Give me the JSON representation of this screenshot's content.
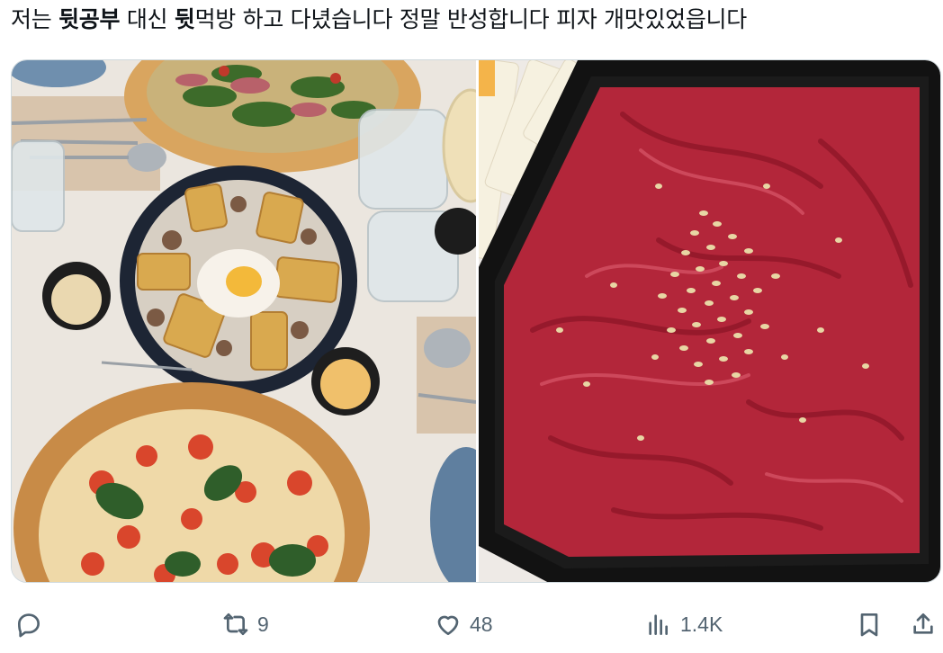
{
  "tweet": {
    "text_parts": [
      {
        "t": "저는 ",
        "bold": false
      },
      {
        "t": "뒷공부",
        "bold": true
      },
      {
        "t": " 대신 ",
        "bold": false
      },
      {
        "t": "뒷",
        "bold": true
      },
      {
        "t": "먹방 하고 다녔습니다 정말 반성합니다 피자 개맛있었읍니다",
        "bold": false
      }
    ]
  },
  "media": {
    "left_photo": {
      "icon": "food-table-photo"
    },
    "right_photo": {
      "icon": "yukhoe-box-photo"
    }
  },
  "actions": {
    "reply": {
      "icon": "reply-icon",
      "count": ""
    },
    "retweet": {
      "icon": "retweet-icon",
      "count": "9"
    },
    "like": {
      "icon": "heart-icon",
      "count": "48"
    },
    "views": {
      "icon": "views-icon",
      "count": "1.4K"
    },
    "bookmark": {
      "icon": "bookmark-icon"
    },
    "share": {
      "icon": "share-icon"
    }
  },
  "colors": {
    "text": "#0f1419",
    "secondary": "#536471",
    "border": "#cfd9de"
  }
}
